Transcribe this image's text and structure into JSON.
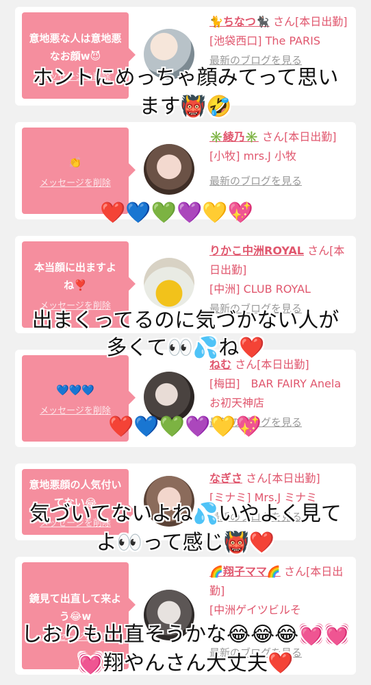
{
  "cards": [
    {
      "message": "意地悪な人は意地悪なお顔w😈",
      "delete": "メッセージを削除",
      "name": "🐈ちなつ🐈‍⬛",
      "san": "さん[本日出勤]",
      "place": "[池袋西口] The PARIS",
      "blog": "最新のブログを見る"
    },
    {
      "message": "👏",
      "delete": "メッセージを削除",
      "name": "✳️綾乃✳️",
      "san": "さん[本日出勤]",
      "place": "[小牧] mrs.J 小牧",
      "blog": "最新のブログを見る"
    },
    {
      "message": "本当顔に出ますよね❣️",
      "delete": "メッセージを削除",
      "name": "りかこ中洲ROYAL",
      "san": "さん[本日出勤]",
      "place": "[中洲] CLUB ROYAL",
      "blog": "最新のブログを見る"
    },
    {
      "message": "💙💙💙",
      "delete": "メッセージを削除",
      "name": "ねむ",
      "san": "さん[本日出勤]",
      "place": "[梅田]　BAR FAIRY Anela　お初天神店",
      "blog": "最新のブログを見る"
    },
    {
      "message": "意地悪顔の人気付いてない😂",
      "delete": "メッセージを削除",
      "name": "なぎさ",
      "san": "さん[本日出勤]",
      "place": "[ミナミ] Mrs.J ミナミ",
      "blog": "最新のブログを見る"
    },
    {
      "message": "鏡見て出直して来よう😂w",
      "delete": "メッセージを削除",
      "name": "🌈翔子ママ🌈",
      "san": "さん[本日出勤]",
      "place": "[中洲ゲイツビルそ",
      "blog": "最新のブログを見る"
    }
  ],
  "overlay": {
    "t1a": "ホントにめっちゃ顔みてって思い",
    "t1b": "ます👹🤣",
    "hearts1": "❤️💙💚💜💛💖",
    "t2a": "出まくってるのに気づかない人が",
    "t2b": "多くて👀💦ね❤️",
    "hearts2": "❤️💙💚💜💛💖",
    "t3a": "気づいてないよね💦いやよく見て",
    "t3b": "よ👀って感じ👹❤️",
    "t4a": "しおりも出直そうかな😂😂😂💓💓",
    "t4b": "💓翔やんさん大丈夫❤️"
  }
}
